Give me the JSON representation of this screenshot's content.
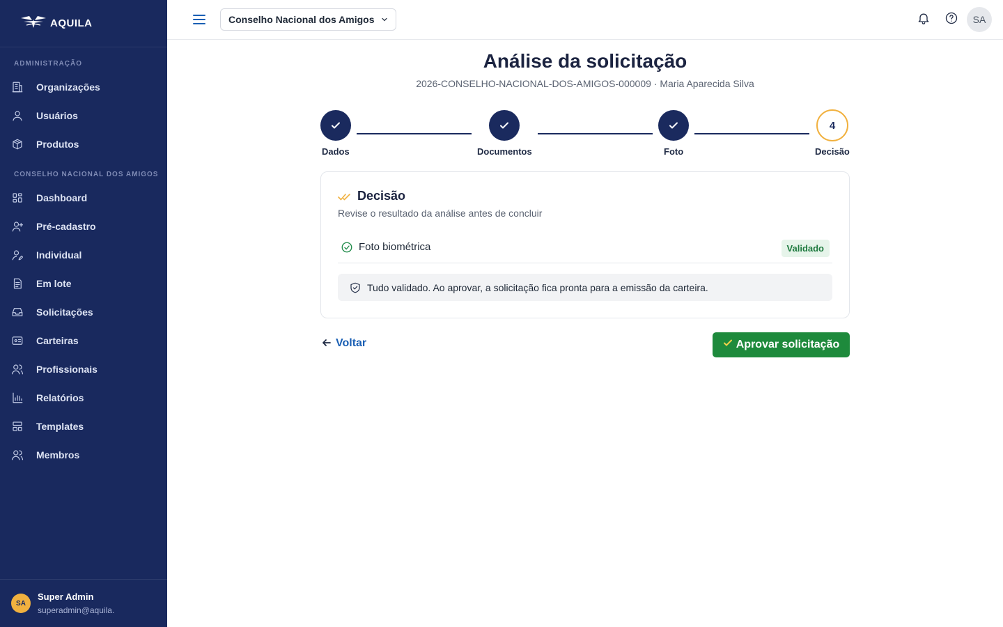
{
  "brand": {
    "name": "AQUILA"
  },
  "sidebar": {
    "section_admin": "ADMINISTRAÇÃO",
    "admin_items": [
      {
        "label": "Organizações",
        "icon": "building-icon"
      },
      {
        "label": "Usuários",
        "icon": "user-icon"
      },
      {
        "label": "Produtos",
        "icon": "box-icon"
      }
    ],
    "section_org": "CONSELHO NACIONAL DOS AMIGOS",
    "org_items": [
      {
        "label": "Dashboard",
        "icon": "dashboard-icon"
      },
      {
        "label": "Pré-cadastro",
        "icon": "user-plus-icon"
      },
      {
        "label": "Individual",
        "icon": "user-edit-icon"
      },
      {
        "label": "Em lote",
        "icon": "file-list-icon"
      },
      {
        "label": "Solicitações",
        "icon": "inbox-icon"
      },
      {
        "label": "Carteiras",
        "icon": "id-card-icon"
      },
      {
        "label": "Profissionais",
        "icon": "users-icon"
      },
      {
        "label": "Relatórios",
        "icon": "bar-chart-icon"
      },
      {
        "label": "Templates",
        "icon": "template-icon"
      },
      {
        "label": "Membros",
        "icon": "members-icon"
      }
    ],
    "user": {
      "initials": "SA",
      "name": "Super Admin",
      "email": "superadmin@aquila."
    }
  },
  "topbar": {
    "org_select": "Conselho Nacional dos Amigos",
    "avatar_initials": "SA"
  },
  "main": {
    "title": "Análise da solicitação",
    "subtitle": "2026-CONSELHO-NACIONAL-DOS-AMIGOS-000009 · Maria Aparecida Silva",
    "steps": [
      {
        "label": "Dados",
        "status": "done"
      },
      {
        "label": "Documentos",
        "status": "done"
      },
      {
        "label": "Foto",
        "status": "done"
      },
      {
        "label": "Decisão",
        "status": "current",
        "number": "4"
      }
    ],
    "card": {
      "title": "Decisão",
      "subtitle": "Revise o resultado da análise antes de concluir",
      "check_label": "Foto biométrica",
      "check_badge": "Validado",
      "notice": "Tudo validado. Ao aprovar, a solicitação fica pronta para a emissão da carteira."
    },
    "back_label": "Voltar",
    "approve_label": "Aprovar solicitação"
  },
  "colors": {
    "sidebar_bg": "#19295e",
    "accent_gold": "#f1b13f",
    "success_green": "#1e8a3c",
    "link_blue": "#1a5fb4"
  }
}
